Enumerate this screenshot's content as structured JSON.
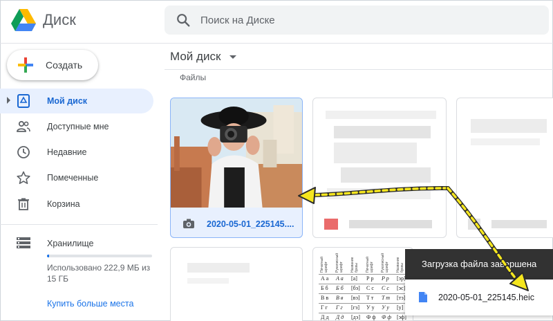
{
  "app": {
    "name": "Диск"
  },
  "search": {
    "placeholder": "Поиск на Диске"
  },
  "create": {
    "label": "Создать"
  },
  "sidebar": {
    "items": [
      {
        "label": "Мой диск",
        "icon": "drive-icon",
        "active": true
      },
      {
        "label": "Доступные мне",
        "icon": "people-icon"
      },
      {
        "label": "Недавние",
        "icon": "clock-icon"
      },
      {
        "label": "Помеченные",
        "icon": "star-icon"
      },
      {
        "label": "Корзина",
        "icon": "trash-icon"
      }
    ],
    "storage": {
      "label": "Хранилище",
      "usage_text": "Использовано 222,9 МБ из 15 ГБ",
      "used_fraction": 0.015,
      "buy_label": "Купить больше места"
    }
  },
  "main": {
    "title": "Мой диск",
    "section_label": "Файлы",
    "files": [
      {
        "name": "2020-05-01_225145....",
        "icon": "camera-icon",
        "selected": true
      }
    ]
  },
  "sheet": {
    "headers": [
      "Печатный шрифт",
      "Рукописный шрифт",
      "Название буквы",
      "Печатный шрифт",
      "Рукописный шрифт",
      "Название буквы"
    ],
    "rows": [
      [
        "А а",
        "A a",
        "[а]",
        "Р р",
        "P p",
        "[эр]"
      ],
      [
        "Б б",
        "Б б",
        "[бэ]",
        "С с",
        "C c",
        "[эс]"
      ],
      [
        "В в",
        "В в",
        "[вэ]",
        "Т т",
        "T m",
        "[тэ]"
      ],
      [
        "Г г",
        "Г г",
        "[гэ]",
        "У у",
        "У у",
        "[у]"
      ],
      [
        "Д д",
        "Д д",
        "[дэ]",
        "Ф ф",
        "Ф ф",
        "[эф]"
      ]
    ]
  },
  "toast": {
    "title": "Загрузка файла завершена",
    "file_name": "2020-05-01_225145.heic",
    "file_icon": "file-icon"
  },
  "colors": {
    "accent": "#1a73e8",
    "active_bg": "#e8f0fe",
    "arrow": "#f5e61e",
    "toast_bg": "#323232"
  }
}
